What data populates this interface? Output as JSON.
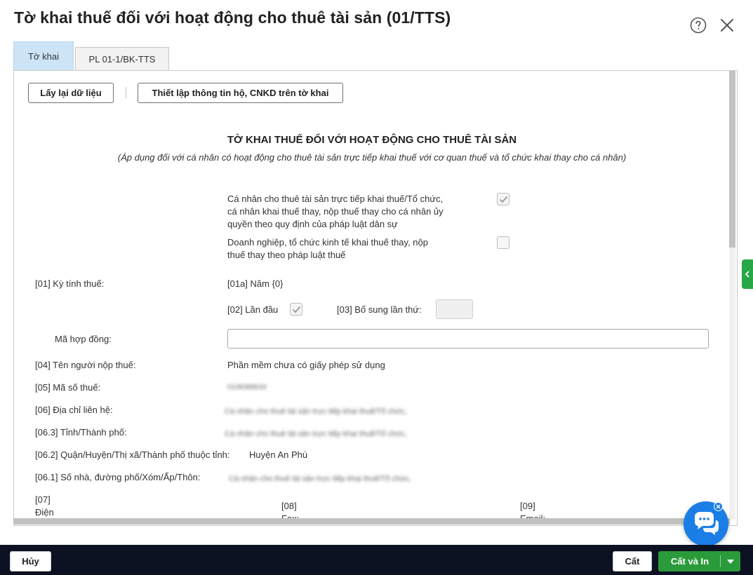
{
  "dialog": {
    "title": "Tờ khai thuế đối với hoạt động cho thuê tài sản (01/TTS)"
  },
  "tabs": [
    {
      "label": "Tờ khai",
      "active": true
    },
    {
      "label": "PL 01-1/BK-TTS",
      "active": false
    }
  ],
  "toolbar": {
    "reload_label": "Lấy lại dữ liệu",
    "setup_label": "Thiết lập thông tin hộ, CNKD trên tờ khai"
  },
  "form": {
    "title": "TỜ KHAI THUẾ ĐỐI VỚI HOẠT ĐỘNG CHO THUÊ TÀI SẢN",
    "subtitle": "(Áp dụng đối với cá nhân có hoạt động cho thuê tài sản trực tiếp khai thuế với cơ quan thuế và tổ chức khai thay cho cá nhân)",
    "option1": {
      "line1": "Cá nhân cho thuê tài sản trực tiếp khai thuế/Tổ chức,",
      "line2": "cá nhân khai thuế thay, nộp thuế thay cho cá nhân ủy",
      "line3": "quyền theo quy định của pháp luật dân sự",
      "checked": true
    },
    "option2": {
      "line1": "Doanh nghiệp, tổ chức kinh tế khai thuế thay, nộp",
      "line2": "thuế thay theo pháp luật thuế",
      "checked": false
    },
    "tax_period_label": "[01] Kỳ tính thuế:",
    "year_label": "[01a] Năm {0}",
    "first_time_label": "[02] Lần đầu",
    "first_time_checked": true,
    "supplement_label": "[03] Bổ sung lần thứ:",
    "supplement_value": "",
    "contract_code_label": "Mã hợp đồng:",
    "contract_code_value": "",
    "taxpayer_name_label": "[04] Tên người nộp thuế:",
    "taxpayer_name_value": "Phần mềm chưa có giấy phép sử dụng",
    "tax_code_label": "[05] Mã số thuế:",
    "tax_code_value": "0108388633",
    "address_label": "[06] Địa chỉ liên hệ:",
    "address_value": "Cá nhân cho thuê tài sản trực tiếp khai thuế/Tổ chức,",
    "province_label": "[06.3] Tỉnh/Thành phố:",
    "province_value": "Cá nhân cho thuê tài sản trực tiếp khai thuế/Tổ chức,",
    "district_label": "[06.2] Quận/Huyện/Thị xã/Thành phố thuộc tỉnh:",
    "district_value": "Huyện An Phú",
    "street_label": "[06.1] Số nhà, đường phố/Xóm/Ấp/Thôn:",
    "street_value": "Cá nhân cho thuê tài sản trực tiếp khai thuế/Tổ chức,",
    "phone_code": "[07]",
    "phone_label": "Điện",
    "fax_code": "[08]",
    "fax_label": "Fax:",
    "email_code": "[09]",
    "email_label": "Email:"
  },
  "footer": {
    "cancel_label": "Hủy",
    "save_label": "Cất",
    "save_print_label": "Cất và In"
  },
  "colors": {
    "tab_active": "#cde4f7",
    "footer_bg": "#0c1222",
    "primary_green": "#2b9a3a",
    "chat_blue": "#1a7ee6"
  },
  "icons": [
    "help-icon",
    "close-icon",
    "check-icon",
    "chevron-left-icon",
    "chat-icon",
    "caret-down-icon"
  ]
}
